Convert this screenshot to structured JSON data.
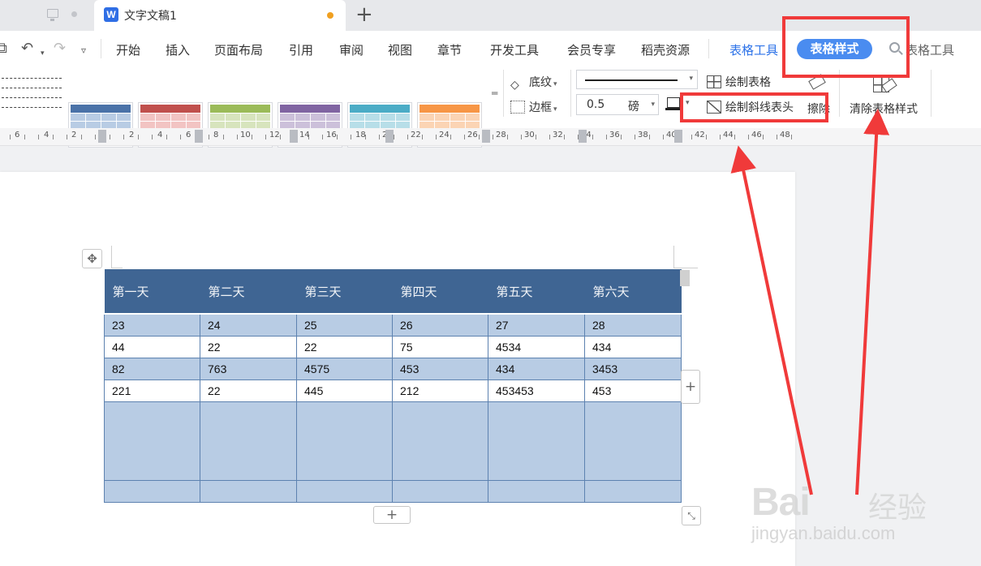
{
  "tab": {
    "title": "文字文稿1",
    "new_tab": "+"
  },
  "menu": {
    "items": [
      "开始",
      "插入",
      "页面布局",
      "引用",
      "审阅",
      "视图",
      "章节",
      "开发工具",
      "会员专享",
      "稻壳资源"
    ],
    "table_tools": "表格工具",
    "table_style": "表格样式",
    "search_text": "表格工具"
  },
  "ribbon": {
    "shading": "底纹",
    "borders": "边框",
    "line_weight": "0.5",
    "line_weight_unit": "磅",
    "draw_table": "绘制表格",
    "draw_diagonal": "绘制斜线表头",
    "erase": "擦除",
    "clear_style": "清除表格样式",
    "style_swatches": [
      {
        "header": "#4a72a8",
        "body": "#b8cce4"
      },
      {
        "header": "#c0504d",
        "body": "#f2c4c3"
      },
      {
        "header": "#9bbb59",
        "body": "#d7e4bd"
      },
      {
        "header": "#8064a2",
        "body": "#ccc0da"
      },
      {
        "header": "#4bacc6",
        "body": "#b7dee8"
      },
      {
        "header": "#f79646",
        "body": "#fbd4b4"
      }
    ]
  },
  "ruler": {
    "labels": [
      "6",
      "4",
      "2",
      "2",
      "4",
      "6",
      "8",
      "10",
      "12",
      "14",
      "16",
      "18",
      "20",
      "22",
      "24",
      "26",
      "28",
      "30",
      "32",
      "34",
      "36",
      "38",
      "40",
      "42",
      "44",
      "46",
      "48"
    ]
  },
  "table": {
    "headers": [
      "第一天",
      "第二天",
      "第三天",
      "第四天",
      "第五天",
      "第六天"
    ],
    "rows": [
      [
        "23",
        "24",
        "25",
        "26",
        "27",
        "28"
      ],
      [
        "44",
        "22",
        "22",
        "75",
        "4534",
        "434"
      ],
      [
        "82",
        "763",
        "4575",
        "453",
        "434",
        "3453"
      ],
      [
        "221",
        "22",
        "445",
        "212",
        "453453",
        "453"
      ]
    ],
    "header_color": "#3f6593",
    "band_color": "#b8cce4"
  },
  "watermark": {
    "brand": "Bai",
    "brand_cn": "经验",
    "url": "jingyan.baidu.com"
  },
  "colors": {
    "accent": "#4a8cf0",
    "highlight": "#f03a3a"
  }
}
